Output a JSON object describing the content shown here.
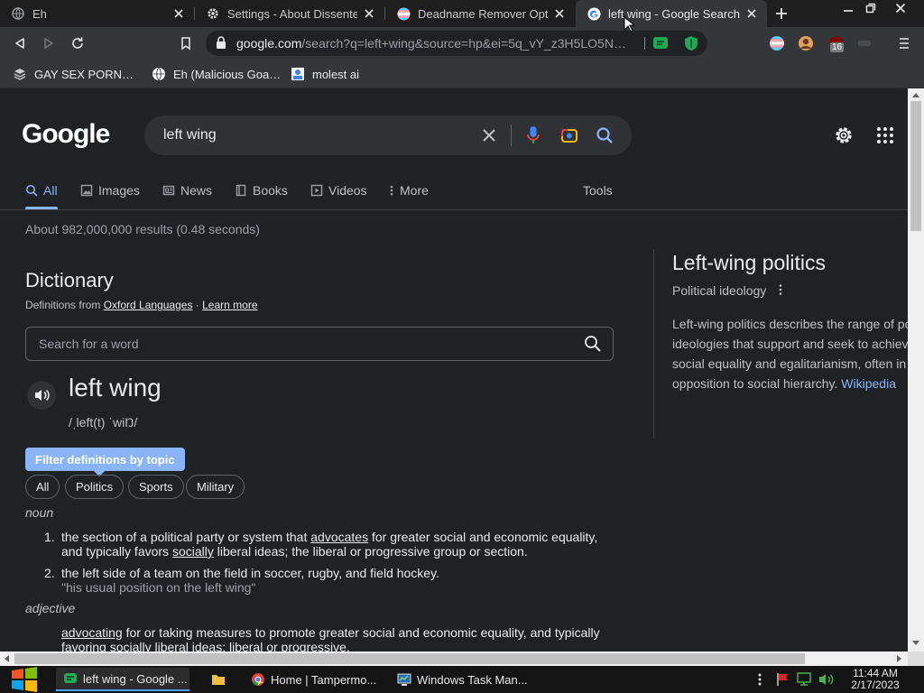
{
  "colors": {
    "link": "#8ab4f8",
    "background": "#202124",
    "tab_active": "#35363a"
  },
  "browser": {
    "tabs": [
      {
        "title": "Eh",
        "icon": "globe-icon",
        "active": false
      },
      {
        "title": "Settings - About Dissenter",
        "icon": "gear-icon",
        "active": false
      },
      {
        "title": "Deadname Remover Options",
        "icon": "trans-flag-icon",
        "active": false
      },
      {
        "title": "left wing - Google Search",
        "icon": "google-icon",
        "active": true
      }
    ],
    "address": {
      "host": "google.com",
      "path": "/search?q=left+wing&source=hp&ei=5q_vY_z3H5LO5N…"
    },
    "extensions_badge": "16",
    "bookmarks": [
      {
        "label": "GAY SEX PORN…"
      },
      {
        "label": "Eh (Malicious Goa…"
      },
      {
        "label": "molest ai"
      }
    ]
  },
  "google": {
    "logo": "Google",
    "query": "left wing",
    "tabs": [
      {
        "label": "All",
        "icon": "search-icon"
      },
      {
        "label": "Images",
        "icon": "image-icon"
      },
      {
        "label": "News",
        "icon": "news-icon"
      },
      {
        "label": "Books",
        "icon": "book-icon"
      },
      {
        "label": "Videos",
        "icon": "video-icon"
      },
      {
        "label": "More",
        "icon": "more-vertical-icon"
      }
    ],
    "tools_label": "Tools",
    "stats": "About 982,000,000 results (0.48 seconds)"
  },
  "dictionary": {
    "title": "Dictionary",
    "source_prefix": "Definitions from ",
    "source_link": "Oxford Languages",
    "separator": " · ",
    "learn_more": "Learn more",
    "search_placeholder": "Search for a word",
    "headword": "left wing",
    "phonetic": "/ˌleft(t) ˈwiŊ/",
    "filter_label": "Filter definitions by topic",
    "chips": [
      "All",
      "Politics",
      "Sports",
      "Military"
    ],
    "noun_label": "noun",
    "adjective_label": "adjective",
    "def1": {
      "num": "1.",
      "a": "the section of a political party or system that ",
      "link": "advocates",
      "b": " for greater social and economic equality,",
      "c": "and typically favors ",
      "link2": "socially",
      "d": " liberal ideas; the liberal or progressive group or section."
    },
    "def2": {
      "num": "2.",
      "text": "the left side of a team on the field in soccer, rugby, and field hockey.",
      "example": "\"his usual position on the left wing\""
    },
    "def3": {
      "link": "advocating",
      "a": " for or taking measures to promote greater social and economic equality, and typically",
      "b": "favoring socially liberal ideas; liberal or progressive."
    }
  },
  "knowledge_panel": {
    "title": "Left-wing politics",
    "subtitle": "Political ideology",
    "description": "Left-wing politics describes the range of political ideologies that support and seek to achieve social equality and egalitarianism, often in opposition to social hierarchy. ",
    "source": "Wikipedia"
  },
  "taskbar": {
    "items": [
      {
        "label": "left wing - Google ..."
      },
      {
        "label": "Home | Tampermo..."
      },
      {
        "label": "Windows Task Man..."
      }
    ],
    "time": "11:44 AM",
    "date": "2/17/2023"
  }
}
